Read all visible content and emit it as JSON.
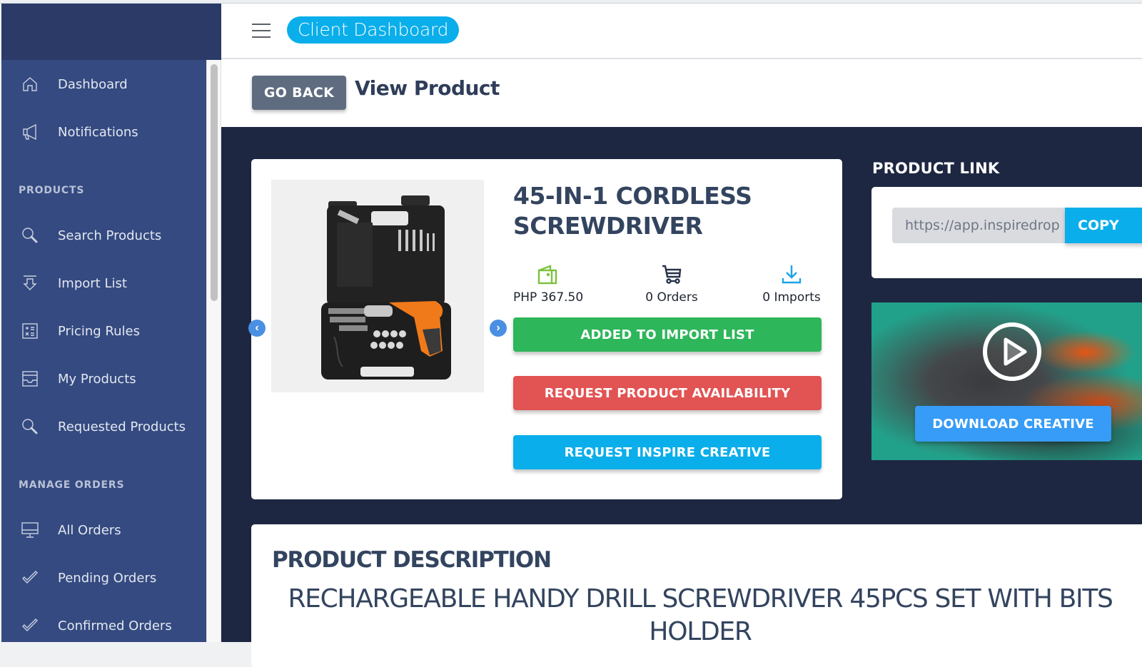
{
  "header": {
    "brand": "Client Dashboard"
  },
  "sidebar": {
    "items": [
      {
        "label": "Dashboard",
        "icon": "home-icon"
      },
      {
        "label": "Notifications",
        "icon": "megaphone-icon"
      }
    ],
    "sections": [
      {
        "title": "PRODUCTS",
        "items": [
          {
            "label": "Search Products",
            "icon": "search-icon"
          },
          {
            "label": "Import List",
            "icon": "import-icon"
          },
          {
            "label": "Pricing Rules",
            "icon": "calculator-icon"
          },
          {
            "label": "My Products",
            "icon": "inbox-icon"
          },
          {
            "label": "Requested Products",
            "icon": "search-icon"
          }
        ]
      },
      {
        "title": "MANAGE ORDERS",
        "items": [
          {
            "label": "All Orders",
            "icon": "monitor-icon"
          },
          {
            "label": "Pending Orders",
            "icon": "check-icon"
          },
          {
            "label": "Confirmed Orders",
            "icon": "double-check-icon"
          }
        ]
      }
    ]
  },
  "page": {
    "go_back": "GO BACK",
    "title": "View Product"
  },
  "product": {
    "title": "45-IN-1 CORDLESS SCREWDRIVER",
    "price": "PHP 367.50",
    "orders": "0 Orders",
    "imports": "0 Imports",
    "buttons": {
      "import": "ADDED TO IMPORT LIST",
      "availability": "REQUEST PRODUCT AVAILABILITY",
      "creative": "REQUEST INSPIRE CREATIVE"
    },
    "colors": {
      "import": "#2eb65a",
      "availability": "#e25353",
      "creative": "#0aaeea",
      "price_icon": "#7cc23c",
      "imports_icon": "#1aa3e8"
    }
  },
  "product_link": {
    "label": "PRODUCT LINK",
    "value": "https://app.inspiredrop",
    "copy": "COPY"
  },
  "creative": {
    "download": "DOWNLOAD CREATIVE"
  },
  "description": {
    "title": "PRODUCT DESCRIPTION",
    "text": "RECHARGEABLE HANDY DRILL SCREWDRIVER 45PCS SET WITH BITS HOLDER"
  }
}
